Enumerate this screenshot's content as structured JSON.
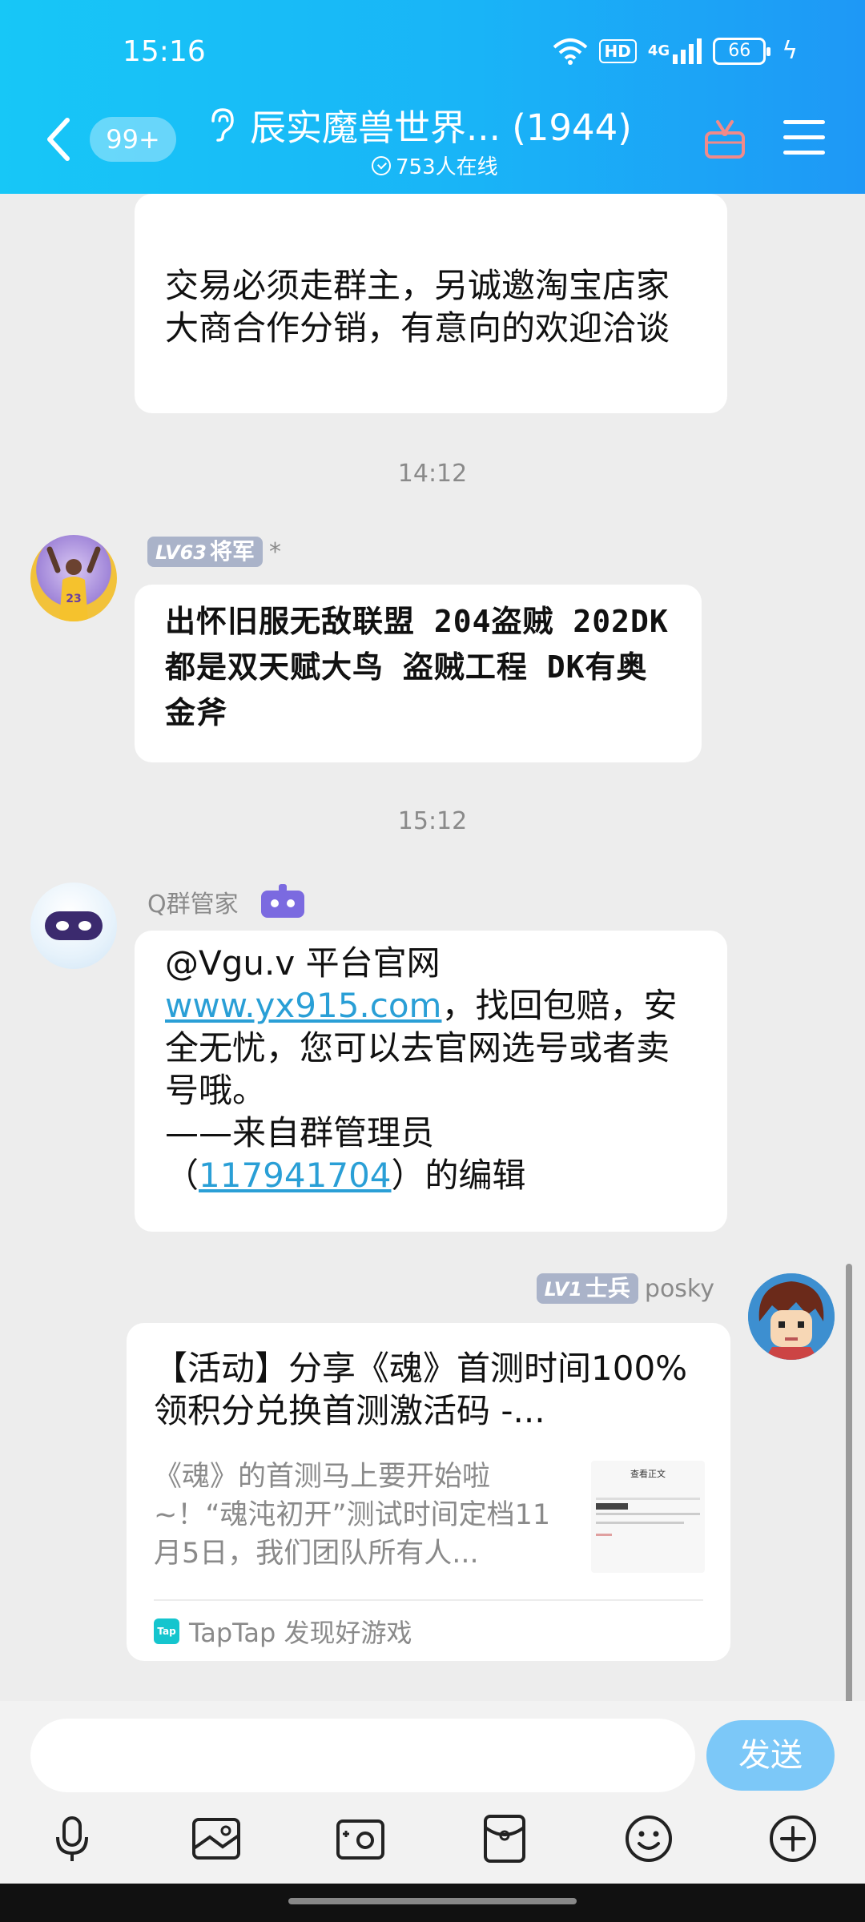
{
  "status_bar": {
    "time": "15:16",
    "hd": "HD",
    "network": "4G",
    "battery": "66"
  },
  "header": {
    "unread_count": "99+",
    "title": "辰实魔兽世界... (1944)",
    "online": "753人在线"
  },
  "messages": [
    {
      "type": "text",
      "text": "交易必须走群主，另诚邀淘宝店家大商合作分销，有意向的欢迎洽谈"
    },
    {
      "type": "timestamp",
      "text": "14:12"
    },
    {
      "type": "text",
      "level_prefix": "LV63",
      "level_title": "将军",
      "sender": "*",
      "text": "出怀旧服无敌联盟 204盗贼 202DK  都是双天赋大鸟 盗贼工程 DK有奥金斧"
    },
    {
      "type": "timestamp",
      "text": "15:12"
    },
    {
      "type": "text",
      "sender": "Q群管家",
      "text_1": "@Vgu.v 平台官网",
      "link": "www.yx915.com",
      "text_2": "，找回包赔，安全无忧，您可以去官网选号或者卖号哦。",
      "text_3": "——来自群管理员",
      "text_4": "（",
      "admin_id": "117941704",
      "text_5": "）的编辑"
    },
    {
      "type": "share_card",
      "level_prefix": "LV1",
      "level_title": "士兵",
      "sender": "posky",
      "title": "【活动】分享《魂》首测时间100%领积分兑换首测激活码 -...",
      "description": "《魂》的首测马上要开始啦~！“魂沌初开”测试时间定档11月5日，我们团队所有人...",
      "thumb_heading": "查看正文",
      "source_icon": "Tap",
      "source": "TapTap 发现好游戏"
    }
  ],
  "composer": {
    "placeholder": "",
    "send_label": "发送"
  },
  "toolbar_icons": [
    "microphone-icon",
    "image-icon",
    "camera-icon",
    "red-packet-icon",
    "emoji-icon",
    "plus-icon"
  ]
}
